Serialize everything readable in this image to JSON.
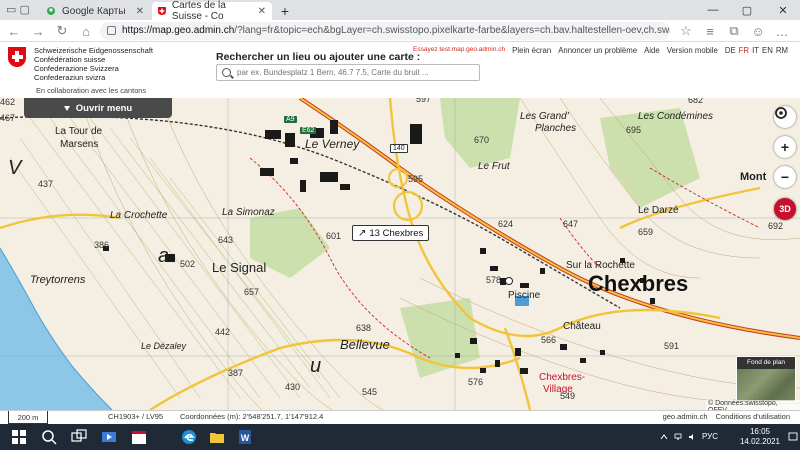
{
  "browser": {
    "tabs": [
      {
        "title": "Google Карты",
        "active": false
      },
      {
        "title": "Cartes de la Suisse - Co",
        "active": true
      }
    ],
    "url_domain": "https://map.geo.admin.ch",
    "url_rest": "/?lang=fr&topic=ech&bgLayer=ch.swisstopo.pixelkarte-farbe&layers=ch.bav.haltestellen-oev,ch.swisstopo.swisstlm3d-wanderwege,"
  },
  "header": {
    "confederation": [
      "Schweizerische Eidgenossenschaft",
      "Confédération suisse",
      "Confederazione Svizzera",
      "Confederaziun svizra"
    ],
    "collab": "En collaboration avec les cantons",
    "search_label": "Rechercher un lieu ou ajouter une carte :",
    "search_placeholder": "par ex. Bundesplatz 1 Bern, 46.7 7.5, Carte du bruit ...",
    "test_link": "Essayez test.map.geo.admin.ch",
    "links": [
      "Plein écran",
      "Annoncer un problème",
      "Aide",
      "Version mobile"
    ],
    "languages": [
      "DE",
      "FR",
      "IT",
      "EN",
      "RM"
    ],
    "active_language": "FR"
  },
  "map": {
    "menu_button": "Ouvrir menu",
    "popup": "13 Chexbres",
    "background_label": "Fond de plan",
    "controls": {
      "zoom_in": "+",
      "zoom_out": "−",
      "three_d": "3D"
    },
    "place_labels": {
      "chexbres": "Chexbres",
      "le_signal": "Le Signal",
      "bellevue": "Bellevue",
      "treytorrens": "Treytorrens",
      "la_crochette": "La Crochette",
      "la_tour_de_marsens": "La Tour de",
      "marsens": "Marsens",
      "le_verney": "Le Verney",
      "la_simonaz": "La Simonaz",
      "le_frut": "Le Frut",
      "les_grand_planches": "Les Grand'",
      "planches": "Planches",
      "les_condemines": "Les Condémines",
      "le_darze": "Le Darzé",
      "sur_la_rochette": "Sur la Rochette",
      "piscine": "Piscine",
      "chateau": "Château",
      "chexbres_village": "Chexbres-",
      "village": "Village",
      "le_dezaley": "Le Dézaley",
      "mont": "Mont",
      "lavaux_v": "V",
      "lavaux_a": "a",
      "lavaux_u": "u"
    },
    "spot_heights": [
      "462",
      "467",
      "597",
      "670",
      "695",
      "682",
      "437",
      "643",
      "624",
      "647",
      "659",
      "692",
      "386",
      "601",
      "578",
      "657",
      "502",
      "442",
      "638",
      "566",
      "591",
      "387",
      "430",
      "545",
      "576",
      "549",
      "595"
    ],
    "road_shields": [
      "A9",
      "E62",
      "140"
    ]
  },
  "footer": {
    "scale": "200 m",
    "crs": "CH1903+ / LV95",
    "coords": "Coordonnées (m): 2'548'251.7, 1'147'912.4",
    "right_links": [
      "geo.admin.ch",
      "Conditions d'utilisation"
    ],
    "copyright": "© Données:swisstopo, OFEV"
  },
  "taskbar": {
    "time": "16:05",
    "date": "14.02.2021",
    "lang": "РУС"
  },
  "colors": {
    "swiss_red": "#e30613",
    "road_yellow": "#f2c43a",
    "lake": "#8cc7e8",
    "forest": "#c8dea8"
  }
}
